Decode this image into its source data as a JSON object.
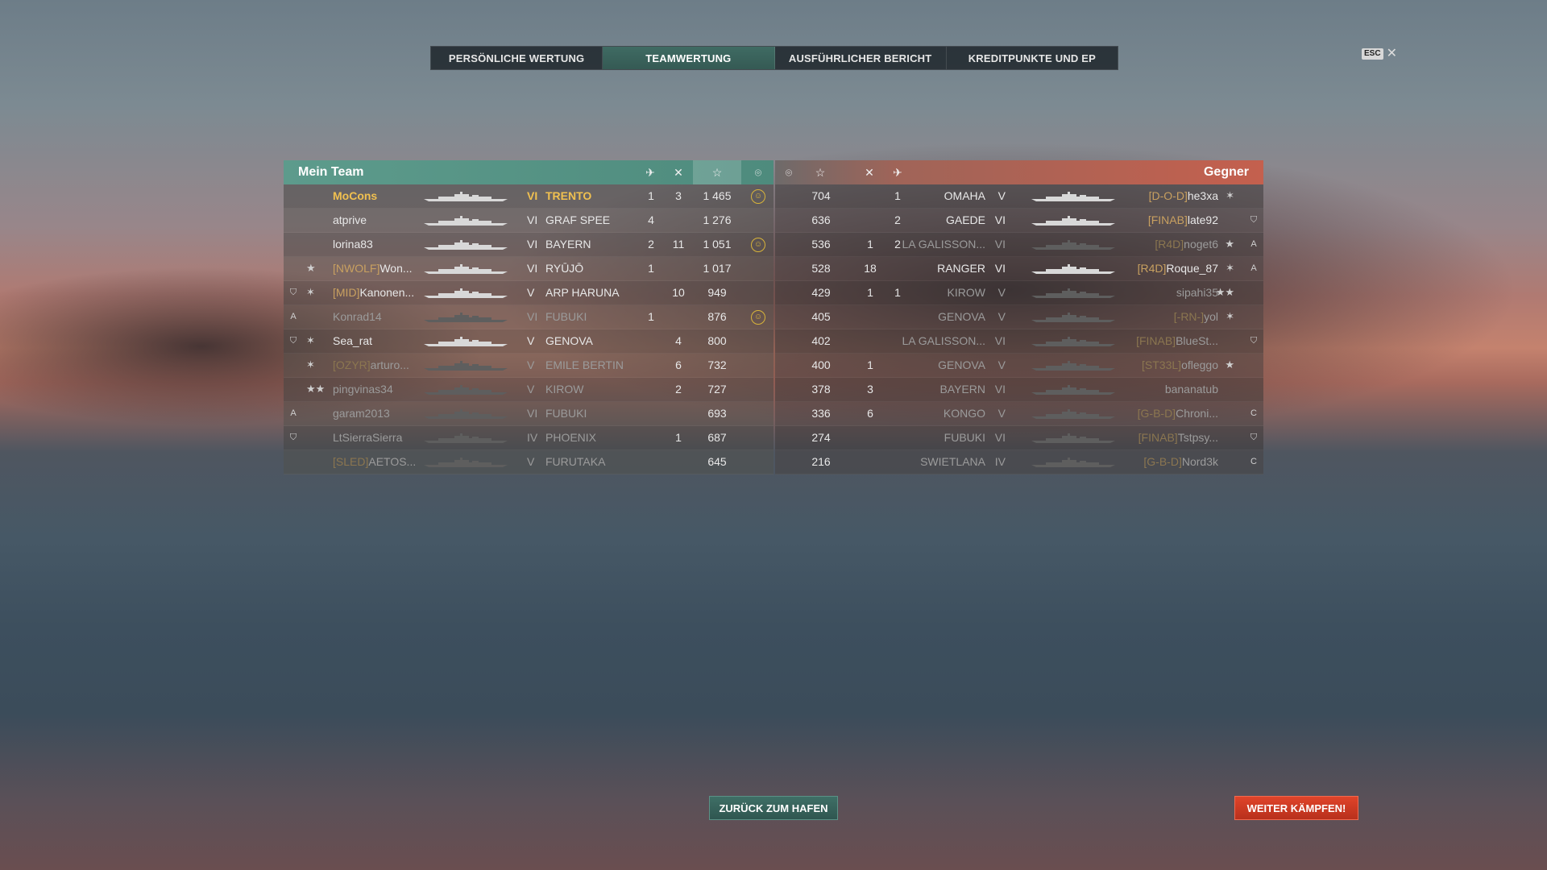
{
  "tabs": [
    {
      "label": "PERSÖNLICHE WERTUNG",
      "active": false
    },
    {
      "label": "TEAMWERTUNG",
      "active": true
    },
    {
      "label": "AUSFÜHRLICHER BERICHT",
      "active": false
    },
    {
      "label": "KREDITPUNKTE UND EP",
      "active": false
    }
  ],
  "esc_label": "ESC",
  "my_team": {
    "title": "Mein Team",
    "header_icons": [
      "planes-shot-icon",
      "ships-destroyed-icon",
      "star-score-icon",
      "laurel-icon"
    ],
    "rows": [
      {
        "badge": "",
        "rank_stars": "",
        "clan": "",
        "name": "MoCons",
        "self": true,
        "tier": "VI",
        "ship": "TRENTO",
        "planes": "1",
        "kills": "3",
        "score": "1 465",
        "achievement": true,
        "dim": false
      },
      {
        "badge": "",
        "rank_stars": "",
        "clan": "",
        "name": "atprive",
        "self": false,
        "tier": "VI",
        "ship": "GRAF SPEE",
        "planes": "4",
        "kills": "",
        "score": "1 276",
        "achievement": false,
        "dim": false
      },
      {
        "badge": "",
        "rank_stars": "",
        "clan": "",
        "name": "lorina83",
        "self": false,
        "tier": "VI",
        "ship": "BAYERN",
        "planes": "2",
        "kills": "11",
        "score": "1 051",
        "achievement": true,
        "dim": false
      },
      {
        "badge": "",
        "rank_stars": "★",
        "clan": "[NWOLF]",
        "name": "Won...",
        "self": false,
        "tier": "VI",
        "ship": "RYŪJŌ",
        "planes": "1",
        "kills": "",
        "score": "1 017",
        "achievement": false,
        "dim": false
      },
      {
        "badge": "shield",
        "rank_stars": "✶",
        "clan": "[MID]",
        "name": "Kanonen...",
        "self": false,
        "tier": "V",
        "ship": "ARP HARUNA",
        "planes": "",
        "kills": "10",
        "score": "949",
        "achievement": false,
        "dim": false
      },
      {
        "badge": "A",
        "rank_stars": "",
        "clan": "",
        "name": "Konrad14",
        "self": false,
        "tier": "VI",
        "ship": "FUBUKI",
        "planes": "1",
        "kills": "",
        "score": "876",
        "achievement": true,
        "dim": true
      },
      {
        "badge": "shield",
        "rank_stars": "✶",
        "clan": "",
        "name": "Sea_rat",
        "self": false,
        "tier": "V",
        "ship": "GENOVA",
        "planes": "",
        "kills": "4",
        "score": "800",
        "achievement": false,
        "dim": false
      },
      {
        "badge": "",
        "rank_stars": "✶",
        "clan": "[OZYR]",
        "name": "arturo...",
        "self": false,
        "tier": "V",
        "ship": "EMILE BERTIN",
        "planes": "",
        "kills": "6",
        "score": "732",
        "achievement": false,
        "dim": true
      },
      {
        "badge": "",
        "rank_stars": "★★",
        "clan": "",
        "name": "pingvinas34",
        "self": false,
        "tier": "V",
        "ship": "KIROW",
        "planes": "",
        "kills": "2",
        "score": "727",
        "achievement": false,
        "dim": true
      },
      {
        "badge": "A",
        "rank_stars": "",
        "clan": "",
        "name": "garam2013",
        "self": false,
        "tier": "VI",
        "ship": "FUBUKI",
        "planes": "",
        "kills": "",
        "score": "693",
        "achievement": false,
        "dim": true
      },
      {
        "badge": "shield",
        "rank_stars": "",
        "clan": "",
        "name": "LtSierraSierra",
        "self": false,
        "tier": "IV",
        "ship": "PHOENIX",
        "planes": "",
        "kills": "1",
        "score": "687",
        "achievement": false,
        "dim": true
      },
      {
        "badge": "",
        "rank_stars": "",
        "clan": "[SLED]",
        "name": "AETOS...",
        "self": false,
        "tier": "V",
        "ship": "FURUTAKA",
        "planes": "",
        "kills": "",
        "score": "645",
        "achievement": false,
        "dim": true
      }
    ]
  },
  "enemy_team": {
    "title": "Gegner",
    "header_icons": [
      "laurel-icon",
      "star-score-icon",
      "ships-destroyed-icon",
      "planes-shot-icon"
    ],
    "rows": [
      {
        "score": "704",
        "kills": "",
        "planes": "1",
        "ship": "OMAHA",
        "tier": "V",
        "clan": "[D-O-D]",
        "name": "he3xa",
        "rank_stars": "✶",
        "badge": "",
        "dim": false
      },
      {
        "score": "636",
        "kills": "",
        "planes": "2",
        "ship": "GAEDE",
        "tier": "VI",
        "clan": "[FINAB]",
        "name": "late92",
        "rank_stars": "",
        "badge": "shield",
        "dim": false
      },
      {
        "score": "536",
        "kills": "1",
        "planes": "2",
        "ship": "LA GALISSON...",
        "tier": "VI",
        "clan": "[R4D]",
        "name": "noget6",
        "rank_stars": "★",
        "badge": "A",
        "dim": true
      },
      {
        "score": "528",
        "kills": "18",
        "planes": "",
        "ship": "RANGER",
        "tier": "VI",
        "clan": "[R4D]",
        "name": "Roque_87",
        "rank_stars": "✶",
        "badge": "A",
        "dim": false
      },
      {
        "score": "429",
        "kills": "1",
        "planes": "1",
        "ship": "KIROW",
        "tier": "V",
        "clan": "",
        "name": "sipahi35",
        "rank_stars": "★★",
        "badge": "",
        "dim": true
      },
      {
        "score": "405",
        "kills": "",
        "planes": "",
        "ship": "GENOVA",
        "tier": "V",
        "clan": "[-RN-]",
        "name": "yol",
        "rank_stars": "✶",
        "badge": "",
        "dim": true
      },
      {
        "score": "402",
        "kills": "",
        "planes": "",
        "ship": "LA GALISSON...",
        "tier": "VI",
        "clan": "[FINAB]",
        "name": "BlueSt...",
        "rank_stars": "",
        "badge": "shield",
        "dim": true
      },
      {
        "score": "400",
        "kills": "1",
        "planes": "",
        "ship": "GENOVA",
        "tier": "V",
        "clan": "[ST33L]",
        "name": "ofleggo",
        "rank_stars": "★",
        "badge": "",
        "dim": true
      },
      {
        "score": "378",
        "kills": "3",
        "planes": "",
        "ship": "BAYERN",
        "tier": "VI",
        "clan": "",
        "name": "bananatub",
        "rank_stars": "",
        "badge": "",
        "dim": true
      },
      {
        "score": "336",
        "kills": "6",
        "planes": "",
        "ship": "KONGO",
        "tier": "V",
        "clan": "[G-B-D]",
        "name": "Chroni...",
        "rank_stars": "",
        "badge": "C",
        "dim": true
      },
      {
        "score": "274",
        "kills": "",
        "planes": "",
        "ship": "FUBUKI",
        "tier": "VI",
        "clan": "[FINAB]",
        "name": "Tstpsy...",
        "rank_stars": "",
        "badge": "shield",
        "dim": true
      },
      {
        "score": "216",
        "kills": "",
        "planes": "",
        "ship": "SWIETLANA",
        "tier": "IV",
        "clan": "[G-B-D]",
        "name": "Nord3k",
        "rank_stars": "",
        "badge": "C",
        "dim": true
      }
    ]
  },
  "buttons": {
    "back_label": "ZURÜCK ZUM HAFEN",
    "fight_label": "WEITER KÄMPFEN!"
  },
  "colors": {
    "my_team_header": "#5d9b8c",
    "enemy_header": "#c4604e",
    "self_highlight": "#f0c050",
    "fight_button": "#e0442a"
  }
}
